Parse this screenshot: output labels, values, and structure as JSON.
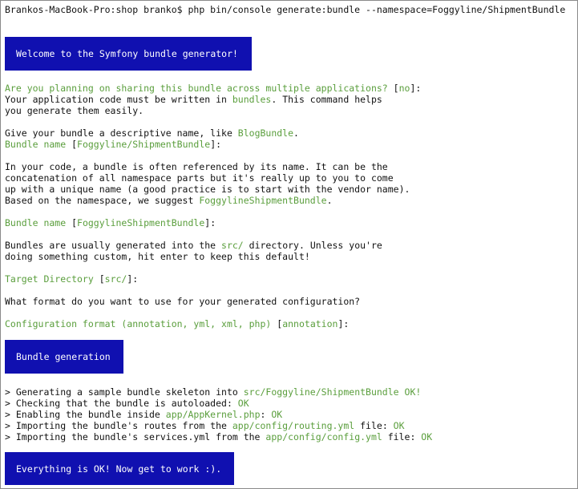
{
  "prompt": "Brankos-MacBook-Pro:shop branko$ php bin/console generate:bundle --namespace=Foggyline/ShipmentBundle",
  "welcome_banner": "Welcome to the Symfony bundle generator!",
  "q_sharing": {
    "question": "Are you planning on sharing this bundle across multiple applications?",
    "default_open": " [",
    "default": "no",
    "default_close": "]:"
  },
  "intro1": {
    "a": "Your application code must be written in ",
    "b": "bundles",
    "c": ". This command helps"
  },
  "intro2": "you generate them easily.",
  "give_name": {
    "a": "Give your bundle a descriptive name, like ",
    "b": "BlogBundle",
    "c": "."
  },
  "q_bundle_name_1": {
    "label": "Bundle name",
    "default_open": " [",
    "default": "Foggyline/ShipmentBundle",
    "default_close": "]:"
  },
  "para_code": [
    "In your code, a bundle is often referenced by its name. It can be the",
    "concatenation of all namespace parts but it's really up to you to come",
    "up with a unique name (a good practice is to start with the vendor name)."
  ],
  "suggest": {
    "a": "Based on the namespace, we suggest ",
    "b": "FoggylineShipmentBundle",
    "c": "."
  },
  "q_bundle_name_2": {
    "label": "Bundle name",
    "default_open": " [",
    "default": "FoggylineShipmentBundle",
    "default_close": "]:"
  },
  "dir1": {
    "a": "Bundles are usually generated into the ",
    "b": "src/",
    "c": " directory. Unless you're"
  },
  "dir2": "doing something custom, hit enter to keep this default!",
  "q_target": {
    "label": "Target Directory",
    "default_open": " [",
    "default": "src/",
    "default_close": "]:"
  },
  "format_question": "What format do you want to use for your generated configuration?",
  "q_config": {
    "label": "Configuration format (annotation, yml, xml, php)",
    "default_open": " [",
    "default": "annotation",
    "default_close": "]:"
  },
  "generation_banner": "Bundle generation",
  "steps": [
    {
      "a": "> Generating a sample bundle skeleton into ",
      "b": "src/Foggyline/ShipmentBundle",
      "c": " ",
      "d": "OK!"
    },
    {
      "a": "> Checking that the bundle is autoloaded: ",
      "b": "",
      "c": "",
      "d": "OK"
    },
    {
      "a": "> Enabling the bundle inside ",
      "b": "app/AppKernel.php",
      "c": ": ",
      "d": "OK"
    },
    {
      "a": "> Importing the bundle's routes from the ",
      "b": "app/config/routing.yml",
      "c": " file: ",
      "d": "OK"
    },
    {
      "a": "> Importing the bundle's services.yml from the ",
      "b": "app/config/config.yml",
      "c": " file: ",
      "d": "OK"
    }
  ],
  "done_banner": "Everything is OK! Now get to work :).",
  "colors": {
    "banner_bg": "#1010b0",
    "banner_text": "#ffffff",
    "highlight": "#5a9e3c",
    "text": "#111111"
  }
}
